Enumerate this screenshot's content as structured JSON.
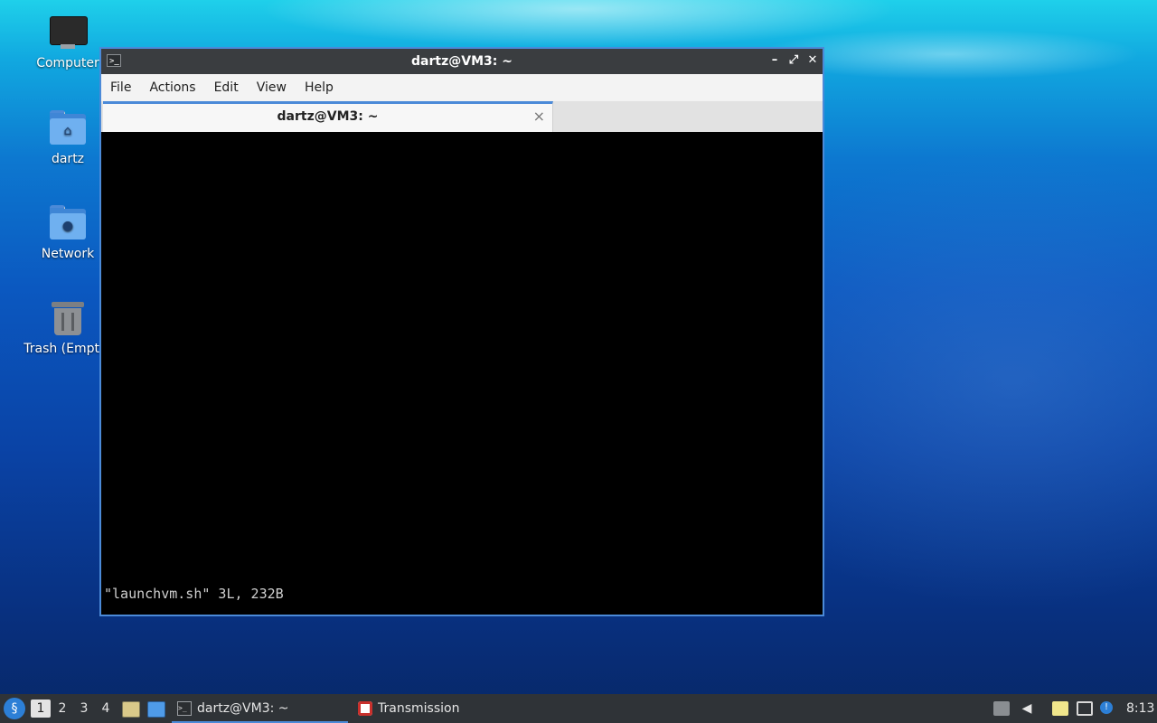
{
  "desktop": {
    "icons": [
      {
        "label": "Computer",
        "icon": "computer-icon"
      },
      {
        "label": "dartz",
        "icon": "home-folder-icon"
      },
      {
        "label": "Network",
        "icon": "network-folder-icon"
      },
      {
        "label": "Trash (Empty)",
        "icon": "trash-icon"
      }
    ]
  },
  "window": {
    "title": "dartz@VM3: ~",
    "controls": {
      "minimize": "–",
      "maximize": "⤢",
      "close": "✕"
    },
    "menu": [
      "File",
      "Actions",
      "Edit",
      "View",
      "Help"
    ],
    "tab": {
      "title": "dartz@VM3: ~",
      "close": "×"
    },
    "terminal": {
      "status_line": "\"launchvm.sh\" 3L, 232B"
    }
  },
  "taskbar": {
    "workspaces": [
      "1",
      "2",
      "3",
      "4"
    ],
    "active_workspace": "1",
    "tasks": [
      {
        "label": "dartz@VM3: ~",
        "icon": "terminal-icon",
        "active": true
      },
      {
        "label": "Transmission",
        "icon": "transmission-icon",
        "active": false
      }
    ],
    "clock": "8:13",
    "accent": "#4b8ad8"
  }
}
